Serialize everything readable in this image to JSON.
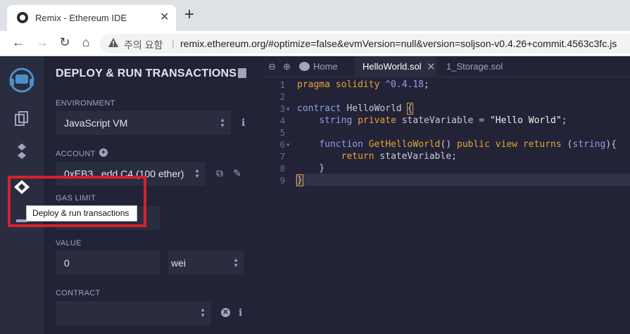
{
  "browser": {
    "tab_title": "Remix - Ethereum IDE",
    "tab_close": "✕",
    "new_tab": "+",
    "back": "←",
    "forward": "→",
    "reload": "↻",
    "home": "⌂",
    "security_warning": "주의 요함",
    "url_separator": "|",
    "url": "remix.ethereum.org/#optimize=false&evmVersion=null&version=soljson-v0.4.26+commit.4563c3fc.js"
  },
  "iconbar": {
    "items": [
      "file-explorers",
      "solidity-compiler",
      "deploy-run",
      "debugger"
    ],
    "tooltip": "Deploy & run transactions"
  },
  "panel": {
    "title": "DEPLOY & RUN TRANSACTIONS",
    "environment_label": "ENVIRONMENT",
    "environment_value": "JavaScript VM",
    "account_label": "ACCOUNT",
    "account_value": "0xEB3...edd C4 (100 ether)",
    "gas_limit_label": "GAS LIMIT",
    "gas_limit_value": "",
    "value_label": "VALUE",
    "value_value": "0",
    "value_unit": "wei",
    "contract_label": "CONTRACT",
    "contract_value": ""
  },
  "editor": {
    "tabs": [
      "Home",
      "HelloWorld.sol",
      "1_Storage.sol"
    ],
    "active_tab": "HelloWorld.sol",
    "line_numbers": [
      "1",
      "2",
      "3",
      "4",
      "5",
      "6",
      "7",
      "8",
      "9"
    ],
    "fold_markers": [
      "▾",
      "▾"
    ]
  },
  "colors": {
    "accent": "#e8a235",
    "highlight_box": "#d7212b",
    "panel_bg": "#222336",
    "iconbar_bg": "#2a2c3f"
  }
}
